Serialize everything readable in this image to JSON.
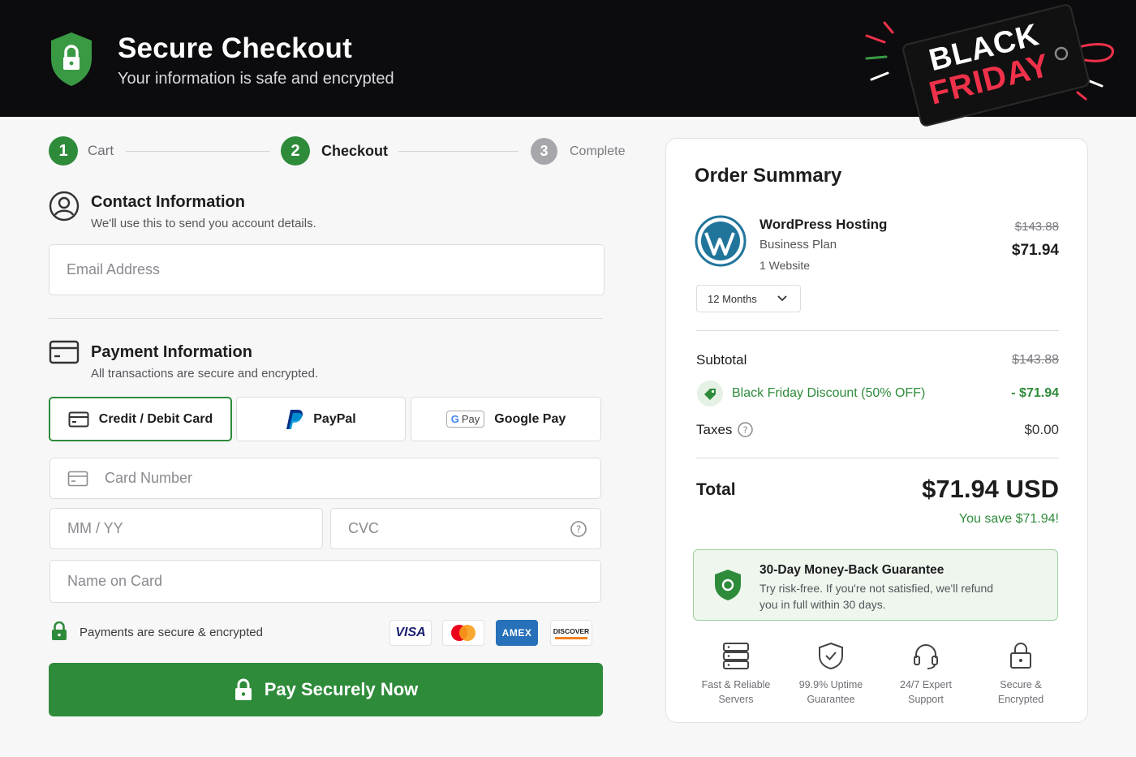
{
  "header": {
    "title": "Secure Checkout",
    "subtitle": "Your information is safe and encrypted",
    "badge_line1": "BLACK",
    "badge_line2": "FRIDAY"
  },
  "steps": [
    {
      "number": "1",
      "label": "Cart",
      "state": "done"
    },
    {
      "number": "2",
      "label": "Checkout",
      "state": "current"
    },
    {
      "number": "3",
      "label": "Complete",
      "state": "upcoming"
    }
  ],
  "contact": {
    "title": "Contact Information",
    "subtitle": "We'll use this to send you account details.",
    "email_placeholder": "Email Address"
  },
  "payment": {
    "title": "Payment Information",
    "subtitle": "All transactions are secure and encrypted.",
    "methods": [
      {
        "label": "Credit / Debit Card",
        "selected": true
      },
      {
        "label": "PayPal",
        "selected": false
      },
      {
        "label": "Google Pay",
        "selected": false,
        "badge": "Pay"
      }
    ],
    "card_number_placeholder": "Card Number",
    "expiry_placeholder": "MM / YY",
    "cvc_placeholder": "CVC",
    "name_placeholder": "Name on Card",
    "secure_note": "Payments are secure & encrypted",
    "card_brands": [
      "VISA",
      "Mastercard",
      "AMEX",
      "DISCOVER"
    ],
    "pay_button": "Pay Securely Now"
  },
  "summary": {
    "title": "Order Summary",
    "product_name": "WordPress Hosting",
    "plan": "Business Plan",
    "sites": "1 Website",
    "original_price": "$143.88",
    "price": "$71.94",
    "term": "12 Months",
    "subtotal_label": "Subtotal",
    "subtotal_value": "$143.88",
    "discount_label": "Black Friday Discount (50% OFF)",
    "discount_value": "- $71.94",
    "taxes_label": "Taxes",
    "taxes_value": "$0.00",
    "total_label": "Total",
    "total_value": "$71.94 USD",
    "savings": "You save $71.94!",
    "guarantee_title": "30-Day Money-Back Guarantee",
    "guarantee_text_line1": "Try risk-free. If you're not satisfied, we'll refund",
    "guarantee_text_line2": "you in full within 30 days.",
    "features": [
      {
        "line1": "Fast & Reliable",
        "line2": "Servers",
        "icon": "server-icon"
      },
      {
        "line1": "99.9% Uptime",
        "line2": "Guarantee",
        "icon": "shield-check-icon"
      },
      {
        "line1": "24/7 Expert",
        "line2": "Support",
        "icon": "headset-icon"
      },
      {
        "line1": "Secure &",
        "line2": "Encrypted",
        "icon": "padlock-icon"
      }
    ]
  },
  "colors": {
    "brand_green": "#2e8b3a",
    "header_bg": "#0c0c0e",
    "black_friday_red": "#f0314a"
  }
}
